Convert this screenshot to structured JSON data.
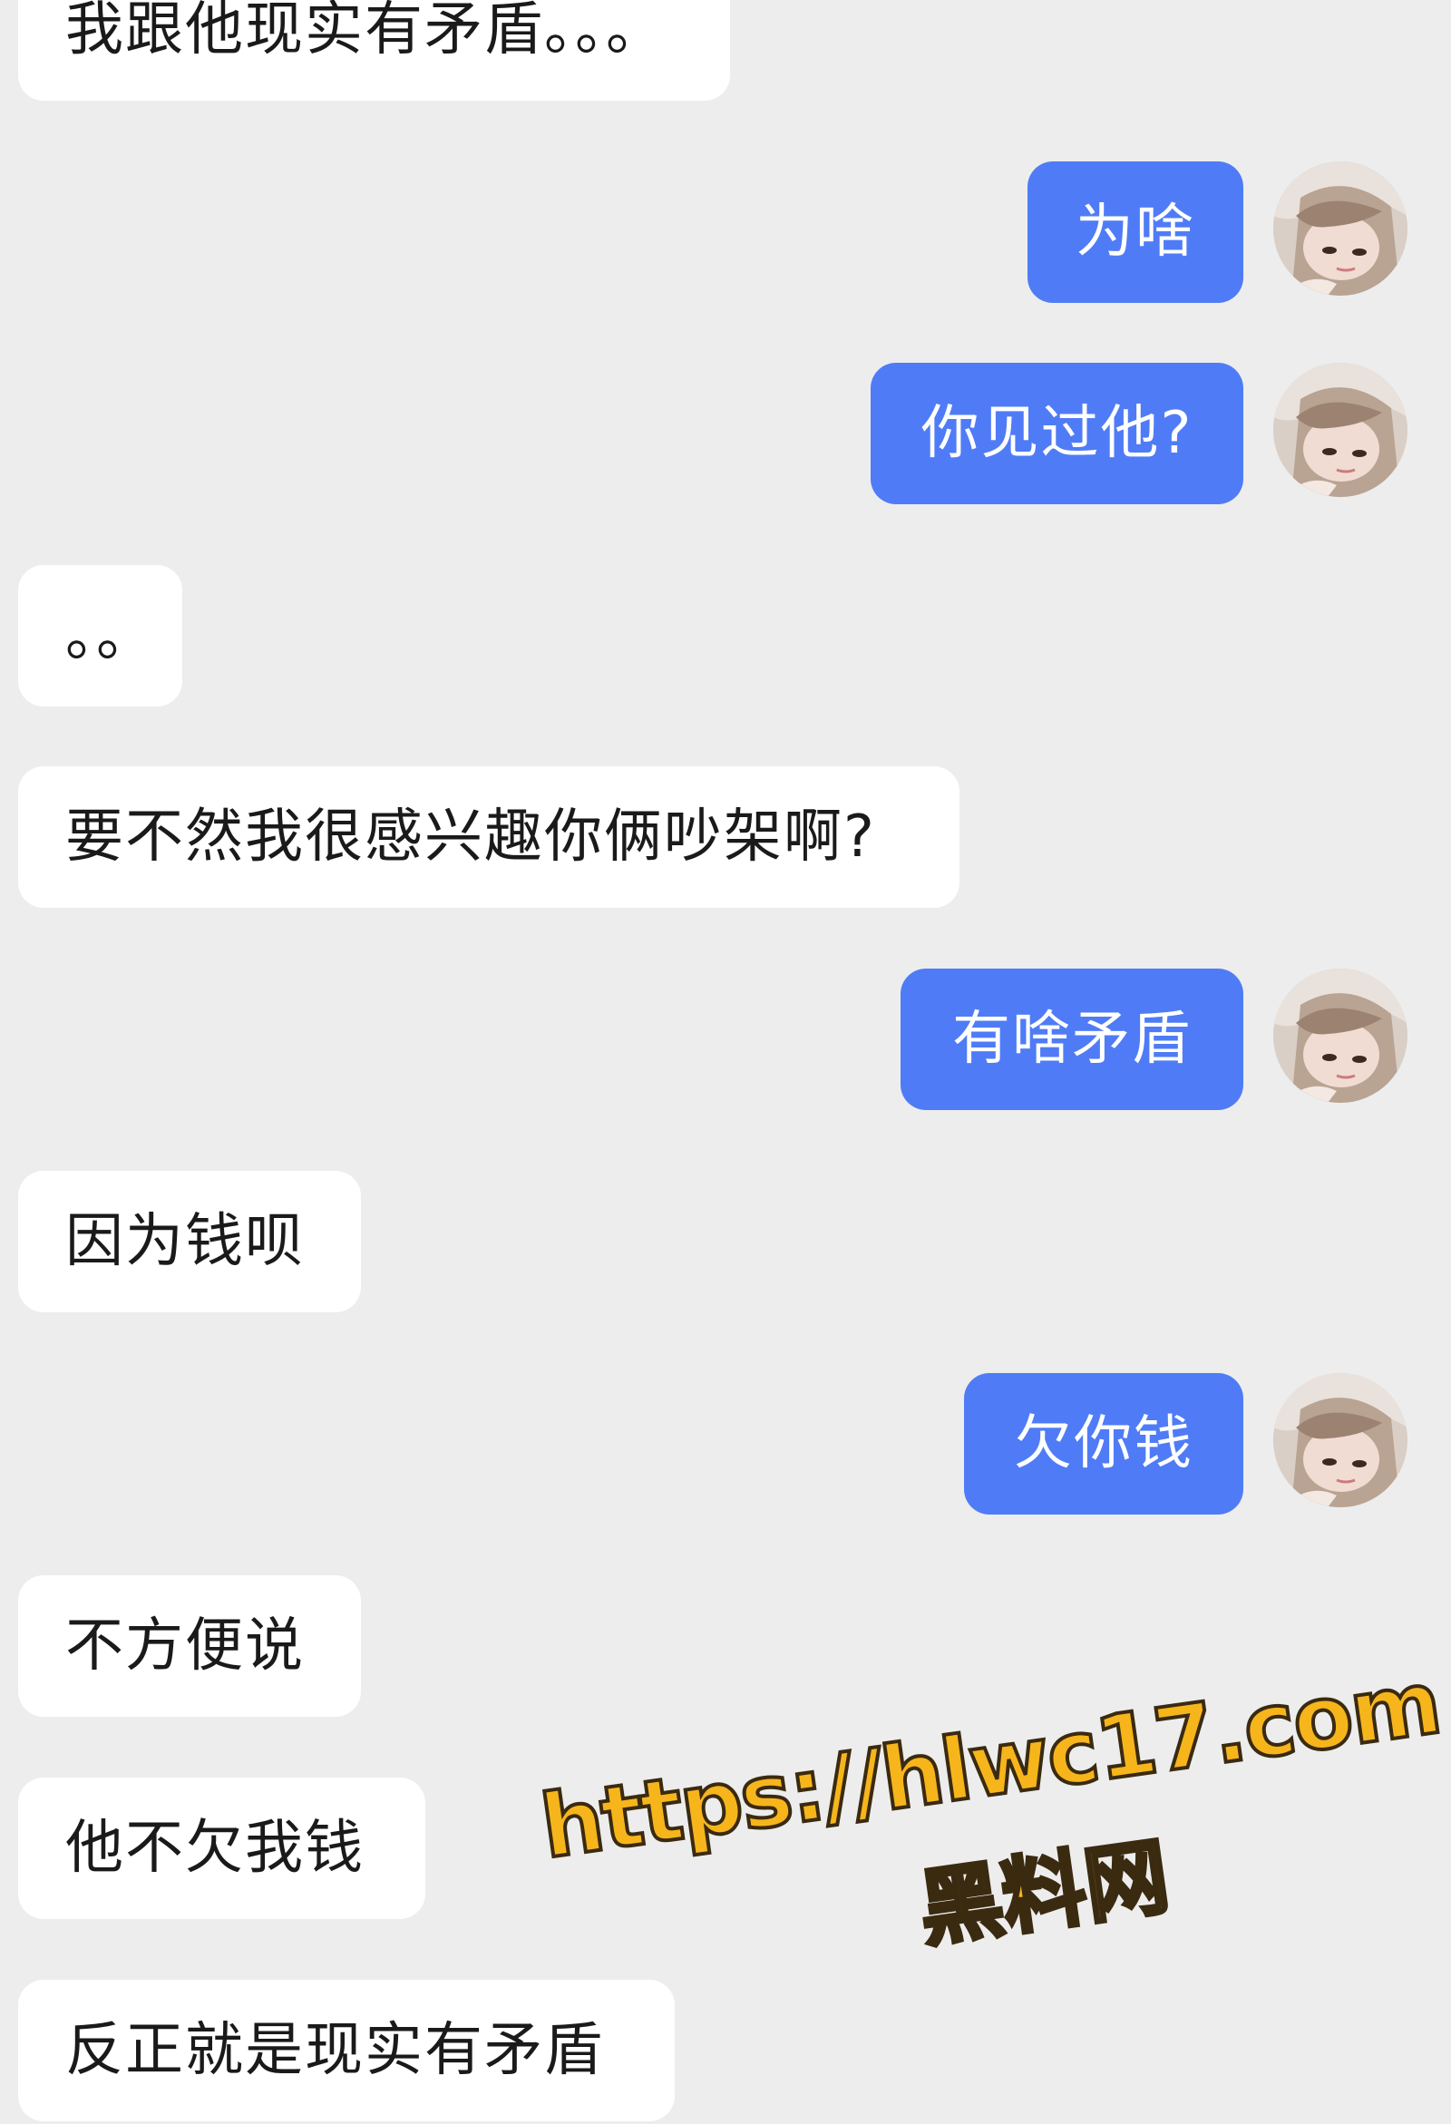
{
  "colors": {
    "background": "#ededed",
    "incoming_bubble": "#ffffff",
    "outgoing_bubble": "#4f7cf6",
    "watermark": "#f7b51c"
  },
  "messages": [
    {
      "side": "in",
      "text": "我跟他现实有矛盾。。。"
    },
    {
      "side": "out",
      "text": "为啥"
    },
    {
      "side": "out",
      "text": "你见过他?"
    },
    {
      "side": "in",
      "text": "。。"
    },
    {
      "side": "in",
      "text": "要不然我很感兴趣你俩吵架啊?"
    },
    {
      "side": "out",
      "text": "有啥矛盾"
    },
    {
      "side": "in",
      "text": "因为钱呗"
    },
    {
      "side": "out",
      "text": "欠你钱"
    },
    {
      "side": "in",
      "text": "不方便说"
    },
    {
      "side": "in",
      "text": "他不欠我钱"
    },
    {
      "side": "in",
      "text": "反正就是现实有矛盾"
    }
  ],
  "watermark": {
    "url": "https://hlwc17.com",
    "name": "黑料网"
  }
}
